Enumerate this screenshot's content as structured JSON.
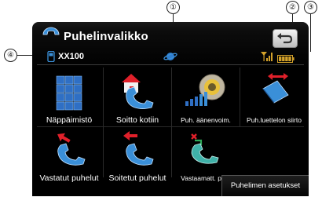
{
  "callouts": [
    "①",
    "②",
    "③",
    "④"
  ],
  "header": {
    "title": "Puhelinvalikko"
  },
  "status": {
    "device_name": "XX100"
  },
  "tiles": [
    {
      "label": "Näppäimistö",
      "icon": "keypad-icon"
    },
    {
      "label": "Soitto kotiin",
      "icon": "call-home-icon"
    },
    {
      "label": "Puh. äänenvoim.",
      "icon": "phone-volume-icon"
    },
    {
      "label": "Puh.luettelon siirto",
      "icon": "phonebook-transfer-icon"
    },
    {
      "label": "Vastatut puhelut",
      "icon": "received-calls-icon"
    },
    {
      "label": "Soitetut puhelut",
      "icon": "dialled-calls-icon"
    },
    {
      "label": "Vastaamatt. puh.",
      "icon": "missed-calls-icon"
    }
  ],
  "footer": {
    "settings_label": "Puhelimen asetukset"
  },
  "colors": {
    "accent_blue": "#3a8fd8",
    "red": "#e0202a",
    "battery": "#d4a22a",
    "signal": "#d4a22a"
  }
}
